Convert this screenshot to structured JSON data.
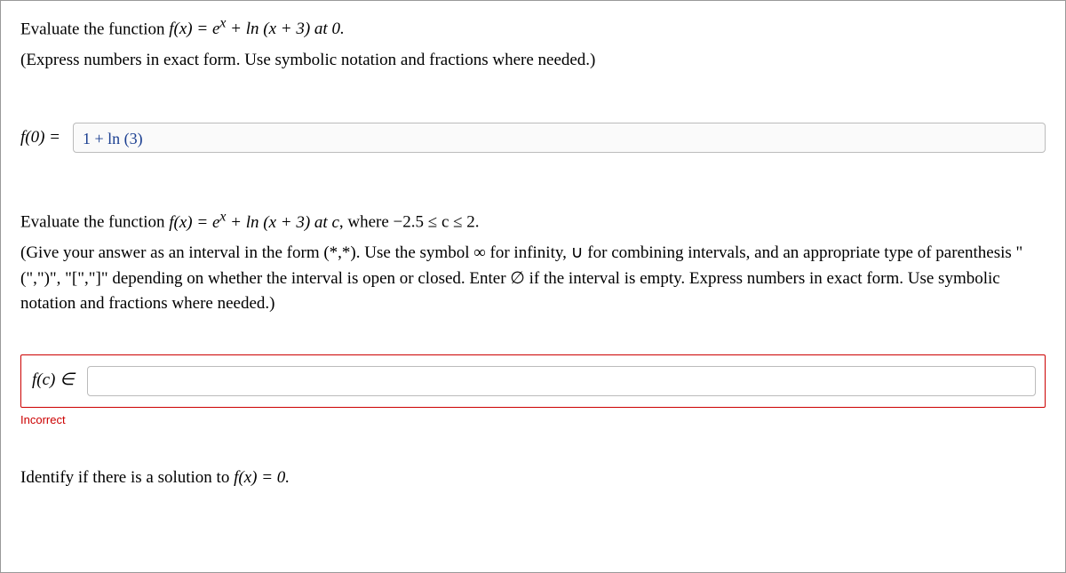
{
  "q1": {
    "prompt_pre": "Evaluate the function ",
    "func": "f(x) = e",
    "func_sup": "x",
    "func_post": " + ln (x + 3) at 0.",
    "hint": "(Express numbers in exact form. Use symbolic notation and fractions where needed.)",
    "label": "f(0) =",
    "value": "1 + ln (3)"
  },
  "q2": {
    "prompt_pre": "Evaluate the function ",
    "func": "f(x) = e",
    "func_sup": "x",
    "func_mid": " + ln (x + 3) at ",
    "cvar": "c",
    "cond": ", where −2.5 ≤ c ≤ 2.",
    "hint": "(Give your answer as an interval in the form (*,*). Use the symbol ∞ for infinity, ∪ for combining intervals, and an appropriate type of parenthesis \"(\",\")\", \"[\",\"]\" depending on whether the interval is open or closed. Enter ∅ if the interval is empty. Express numbers in exact form. Use symbolic notation and fractions where needed.)",
    "label": "f(c) ∈",
    "value": "",
    "error": "Incorrect"
  },
  "q3": {
    "prompt_pre": "Identify if there is a solution to ",
    "func": "f(x) = 0."
  }
}
